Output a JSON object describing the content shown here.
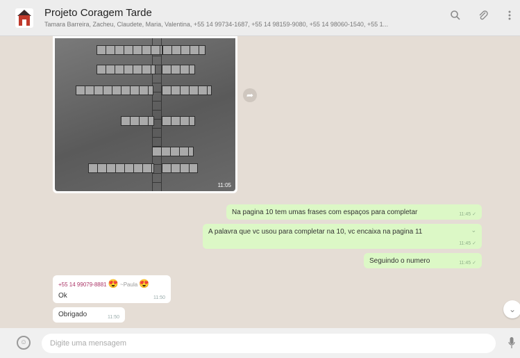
{
  "header": {
    "title": "Projeto Coragem Tarde",
    "members": "Tamara Barreira, Zacheu, Claudete, Maria, Valentina, +55 14 99734-1687, +55 14 98159-9080, +55 14 98060-1540, +55 1...",
    "icons": [
      "search-icon",
      "attach-icon",
      "menu-icon"
    ]
  },
  "messages": {
    "image": {
      "time": "11:05"
    },
    "out1": {
      "text": "Na pagina 10 tem umas frases com espaços para completar",
      "time": "11:45"
    },
    "out2": {
      "text": "A palavra que vc usou para completar na 10, vc encaixa na pagina 11",
      "time": "11:45"
    },
    "out3": {
      "text": "Seguindo o numero",
      "time": "11:45"
    },
    "in1": {
      "sender": "+55 14 99079-8881",
      "sender_extra": "~Paula",
      "text": "Ok",
      "time": "11:50"
    },
    "in2": {
      "text": "Obrigado",
      "time": "11:50"
    }
  },
  "composer": {
    "placeholder": "Digite uma mensagem"
  },
  "colors": {
    "outgoing": "#dcf8c6",
    "incoming": "#ffffff",
    "background": "#e5ddd5",
    "header": "#ededed"
  }
}
